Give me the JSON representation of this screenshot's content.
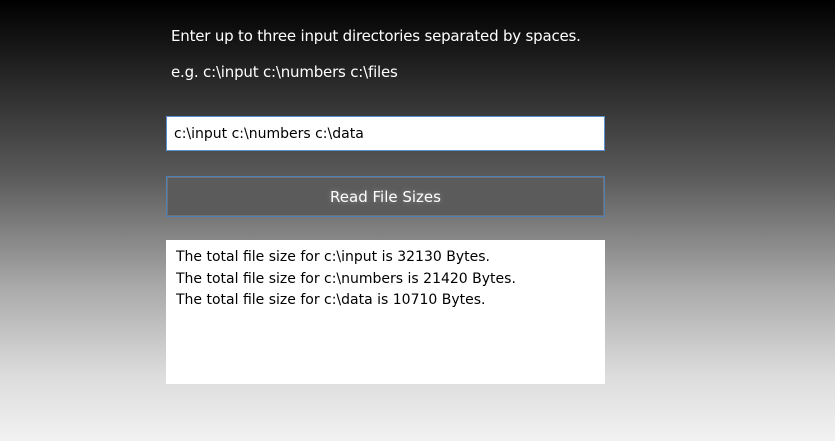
{
  "instructions": {
    "line1": "Enter up to three input directories separated by spaces.",
    "line2": "e.g. c:\\input c:\\numbers c:\\files"
  },
  "directories_input": {
    "value": "c:\\input c:\\numbers c:\\data"
  },
  "read_button": {
    "label": "Read File Sizes"
  },
  "results": [
    "The total file size for c:\\input is 32130 Bytes.",
    "The total file size for c:\\numbers is 21420 Bytes.",
    "The total file size for c:\\data is 10710 Bytes."
  ],
  "colors": {
    "input_border": "#5a8fd0",
    "button_background": "#5b5b5b",
    "button_border": "#4f7fb8"
  }
}
